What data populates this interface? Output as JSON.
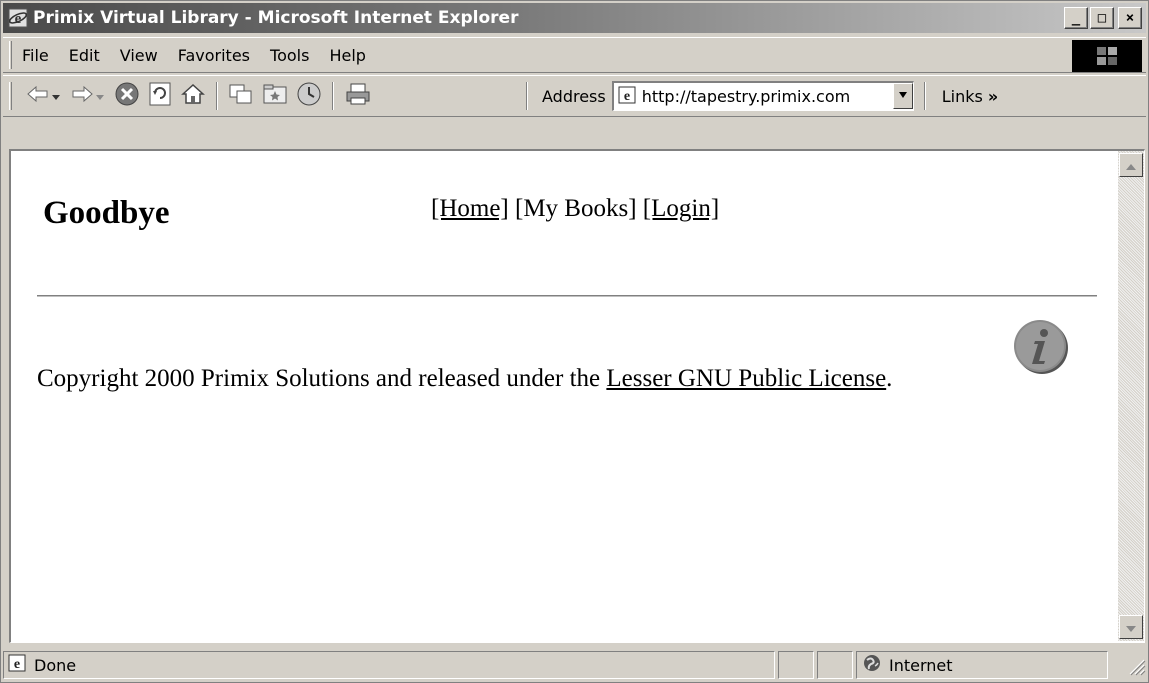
{
  "window": {
    "title": "Primix Virtual Library - Microsoft Internet Explorer",
    "buttons": {
      "minimize": "_",
      "maximize": "□",
      "close": "×"
    }
  },
  "menubar": {
    "items": [
      {
        "label": "File"
      },
      {
        "label": "Edit"
      },
      {
        "label": "View"
      },
      {
        "label": "Favorites"
      },
      {
        "label": "Tools"
      },
      {
        "label": "Help"
      }
    ]
  },
  "toolbar": {
    "address_label": "Address",
    "address_value": "http://tapestry.primix.com",
    "links_label": "Links",
    "links_chevron": "»",
    "icons": [
      "back-icon",
      "forward-icon",
      "stop-icon",
      "refresh-icon",
      "home-icon",
      "search-icon",
      "favorites-icon",
      "history-icon",
      "print-icon"
    ]
  },
  "page": {
    "title": "Goodbye",
    "nav": {
      "home": "[Home]",
      "my_books": "[My Books]",
      "login": "[Login]"
    },
    "copyright_prefix": "Copyright 2000 Primix Solutions and released under the",
    "license_link": "Lesser GNU Public License",
    "copyright_suffix": "."
  },
  "statusbar": {
    "status_text": "Done",
    "zone_text": "Internet"
  }
}
